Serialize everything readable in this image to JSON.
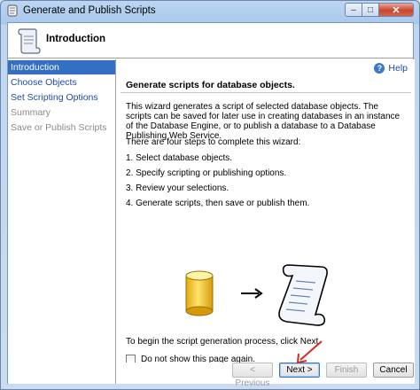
{
  "window": {
    "title": "Generate and Publish Scripts"
  },
  "controls": {
    "minimize": "–",
    "maximize": "□",
    "close": "✕"
  },
  "header": {
    "title": "Introduction"
  },
  "nav": {
    "items": [
      {
        "label": "Introduction",
        "state": "active"
      },
      {
        "label": "Choose Objects",
        "state": "link"
      },
      {
        "label": "Set Scripting Options",
        "state": "link"
      },
      {
        "label": "Summary",
        "state": "disabled"
      },
      {
        "label": "Save or Publish Scripts",
        "state": "disabled"
      }
    ]
  },
  "help": {
    "label": "Help"
  },
  "content": {
    "heading": "Generate scripts for database objects.",
    "para1": "This wizard generates a script of selected database objects. The scripts can be saved for later use in creating databases in an instance of the Database Engine, or to publish a database to a Database Publishing Web Service.",
    "para2": "There are four steps to complete this wizard:",
    "steps": [
      "1. Select database objects.",
      "2. Specify scripting or publishing options.",
      "3. Review your selections.",
      "4. Generate scripts, then save or publish them."
    ],
    "footer_text": "To begin the script generation process, click Next.",
    "checkbox_label": "Do not show this page again."
  },
  "buttons": {
    "previous": "< Previous",
    "next": "Next >",
    "finish": "Finish",
    "cancel": "Cancel"
  },
  "colors": {
    "selected_nav": "#3370c4",
    "link": "#1f4aa5",
    "arrow": "#d22b1f"
  }
}
